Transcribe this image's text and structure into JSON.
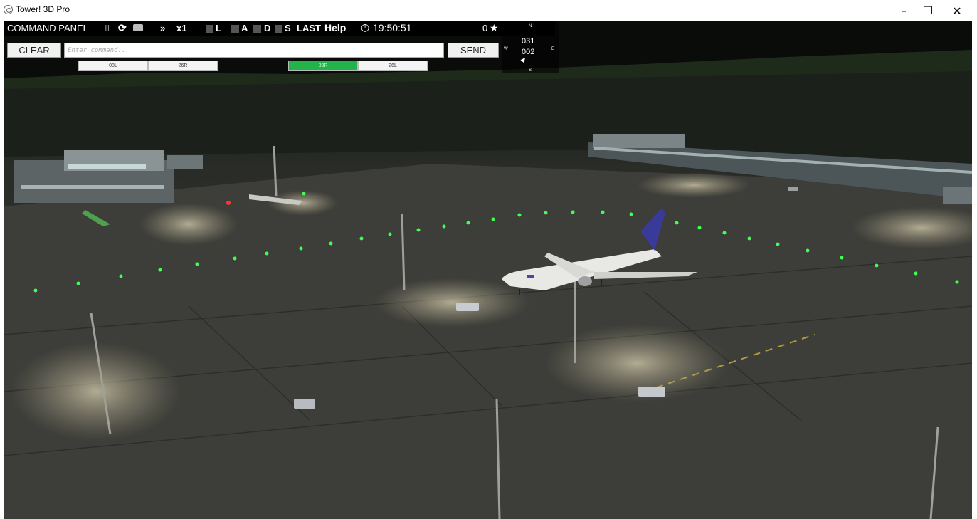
{
  "window": {
    "title": "Tower! 3D Pro",
    "minimize_glyph": "–",
    "maximize_glyph": "❐",
    "close_glyph": "✕"
  },
  "command_panel": {
    "label": "COMMAND PANEL",
    "pause_glyph": "II",
    "reset_glyph": "⟳",
    "camera_icon": "camera-icon",
    "fast_forward_glyph": "»",
    "speed": "x1",
    "toggle_l": "L",
    "toggle_a": "A",
    "toggle_d": "D",
    "toggle_s": "S",
    "last_label": "LAST",
    "help_label": "Help",
    "clock_glyph": "◷",
    "clock": "19:50:51",
    "score": "0",
    "star_glyph": "★",
    "clear_label": "CLEAR",
    "input_placeholder": "Enter command...",
    "send_label": "SEND"
  },
  "runways": [
    {
      "label": "08L",
      "active": false
    },
    {
      "label": "26R",
      "active": false
    },
    {
      "label": "08R",
      "active": true
    },
    {
      "label": "26L",
      "active": false
    }
  ],
  "compass": {
    "north": "N",
    "south": "S",
    "west": "W",
    "east": "E",
    "wind_direction": "031",
    "wind_speed": "002"
  },
  "colors": {
    "runway_active": "#22b34a",
    "taxi_light": "#3fff55",
    "panel_bg": "#000000"
  }
}
